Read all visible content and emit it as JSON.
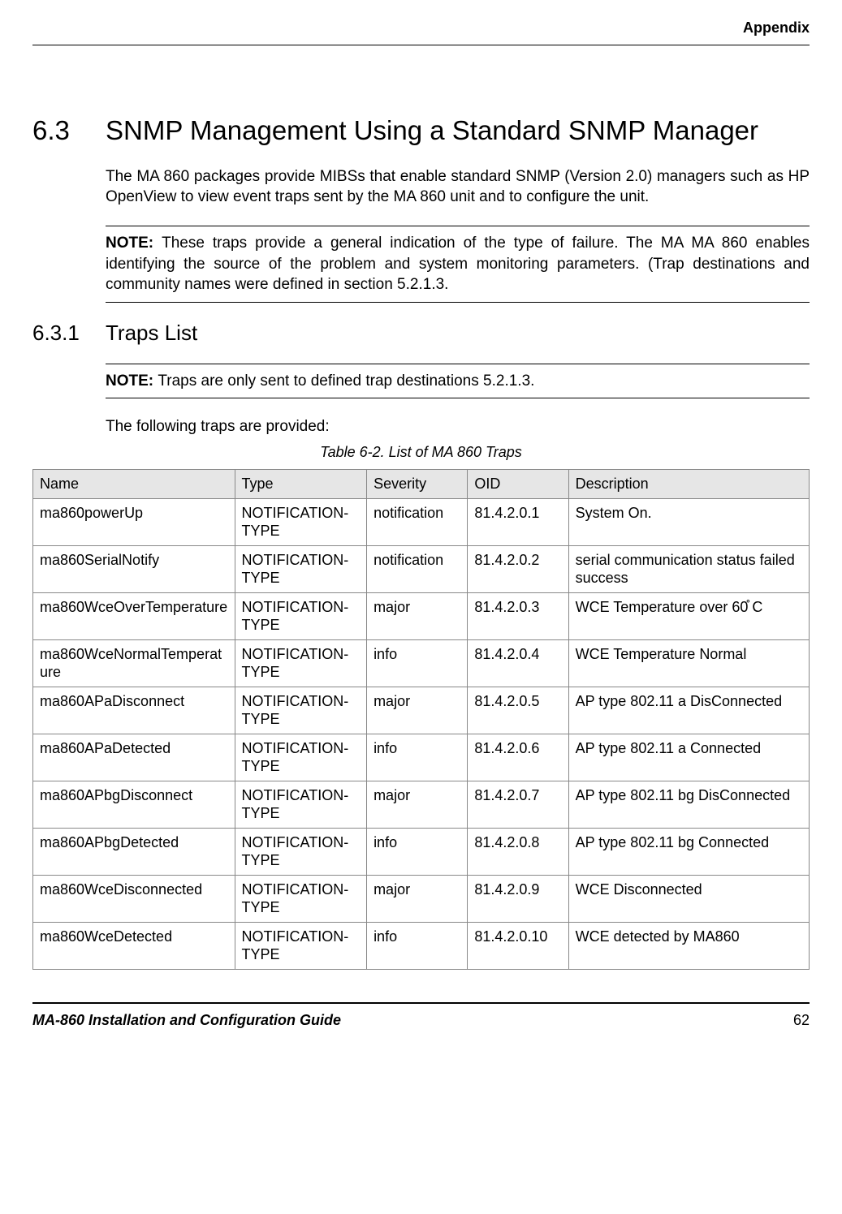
{
  "header": {
    "label": "Appendix"
  },
  "section": {
    "number": "6.3",
    "title": "SNMP Management Using a Standard SNMP Manager",
    "para1": "The MA 860 packages provide MIBSs that enable standard SNMP (Version 2.0) managers such as HP OpenView to view event traps sent by the MA 860 unit and to configure the unit.",
    "note1_label": "NOTE: ",
    "note1_text": "These traps provide a general indication of the type of failure.  The MA MA 860 enables identifying the source of the problem and system monitoring parameters. (Trap destinations and community names were defined in section 5.2.1.3."
  },
  "subsection": {
    "number": "6.3.1",
    "title": "Traps List",
    "note2_label": "NOTE: ",
    "note2_text": "Traps are only sent to defined trap destinations 5.2.1.3.",
    "para2": "The following traps are provided:",
    "table_caption": "Table 6-2. List of MA 860 Traps"
  },
  "table": {
    "headers": {
      "name": "Name",
      "type": "Type",
      "severity": "Severity",
      "oid": "OID",
      "description": "Description"
    },
    "rows": [
      {
        "name": "ma860powerUp",
        "type": "NOTIFICATION-TYPE",
        "severity": "notification",
        "oid": "81.4.2.0.1",
        "description": "System On."
      },
      {
        "name": "ma860SerialNotify",
        "type": "NOTIFICATION-TYPE",
        "severity": "notification",
        "oid": "81.4.2.0.2",
        "description": "serial communication status failed success"
      },
      {
        "name": "ma860WceOverTemperature",
        "type": "NOTIFICATION-TYPE",
        "severity": "major",
        "oid": "81.4.2.0.3",
        "description": "WCE Temperature over 60̊ C"
      },
      {
        "name": "ma860WceNormalTemperature",
        "type": "NOTIFICATION-TYPE",
        "severity": "info",
        "oid": "81.4.2.0.4",
        "description": "WCE Temperature Normal"
      },
      {
        "name": "ma860APaDisconnect",
        "type": "NOTIFICATION-TYPE",
        "severity": "major",
        "oid": "81.4.2.0.5",
        "description": "AP type 802.11 a DisConnected"
      },
      {
        "name": "ma860APaDetected",
        "type": "NOTIFICATION-TYPE",
        "severity": "info",
        "oid": "81.4.2.0.6",
        "description": "AP type 802.11 a Connected"
      },
      {
        "name": "ma860APbgDisconnect",
        "type": "NOTIFICATION-TYPE",
        "severity": "major",
        "oid": "81.4.2.0.7",
        "description": "AP type 802.11 bg DisConnected"
      },
      {
        "name": "ma860APbgDetected",
        "type": "NOTIFICATION-TYPE",
        "severity": "info",
        "oid": "81.4.2.0.8",
        "description": "AP type 802.11 bg Connected"
      },
      {
        "name": "ma860WceDisconnected",
        "type": "NOTIFICATION-TYPE",
        "severity": "major",
        "oid": "81.4.2.0.9",
        "description": "WCE Disconnected"
      },
      {
        "name": "ma860WceDetected",
        "type": "NOTIFICATION-TYPE",
        "severity": "info",
        "oid": "81.4.2.0.10",
        "description": "WCE detected by MA860"
      }
    ]
  },
  "footer": {
    "title": "MA-860 Installation and Configuration Guide",
    "page": "62"
  }
}
